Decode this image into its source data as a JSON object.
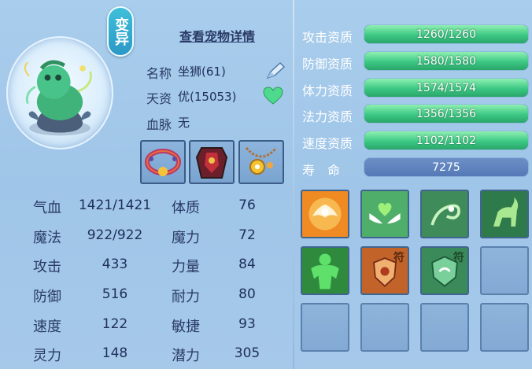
{
  "pet": {
    "mutant_badge": "变异",
    "detail_link": "查看宠物详情",
    "name_label": "名称",
    "name_value": "坐狮(61)",
    "talent_label": "天资",
    "talent_value": "优(15053)",
    "bloodline_label": "血脉",
    "bloodline_value": "无"
  },
  "stats": {
    "hp_label": "气血",
    "hp_value": "1421/1421",
    "constitution_label": "体质",
    "constitution_value": "76",
    "mp_label": "魔法",
    "mp_value": "922/922",
    "magic_label": "魔力",
    "magic_value": "72",
    "attack_label": "攻击",
    "attack_value": "433",
    "strength_label": "力量",
    "strength_value": "84",
    "defense_label": "防御",
    "defense_value": "516",
    "endurance_label": "耐力",
    "endurance_value": "80",
    "speed_label": "速度",
    "speed_value": "122",
    "agility_label": "敏捷",
    "agility_value": "93",
    "spirit_label": "灵力",
    "spirit_value": "148",
    "potential_label": "潜力",
    "potential_value": "305"
  },
  "aptitudes": [
    {
      "label": "攻击资质",
      "value": "1260/1260",
      "fill": 1.0
    },
    {
      "label": "防御资质",
      "value": "1580/1580",
      "fill": 1.0
    },
    {
      "label": "体力资质",
      "value": "1574/1574",
      "fill": 1.0
    },
    {
      "label": "法力资质",
      "value": "1356/1356",
      "fill": 1.0
    },
    {
      "label": "速度资质",
      "value": "1102/1102",
      "fill": 1.0
    }
  ],
  "lifespan": {
    "label": "寿　命",
    "value": "7275"
  },
  "skills": {
    "talisman_badge": "符"
  },
  "colors": {
    "bar_green": "#3cc884",
    "bar_blue": "#5579b6",
    "panel_bg": "#a6c9ea"
  }
}
